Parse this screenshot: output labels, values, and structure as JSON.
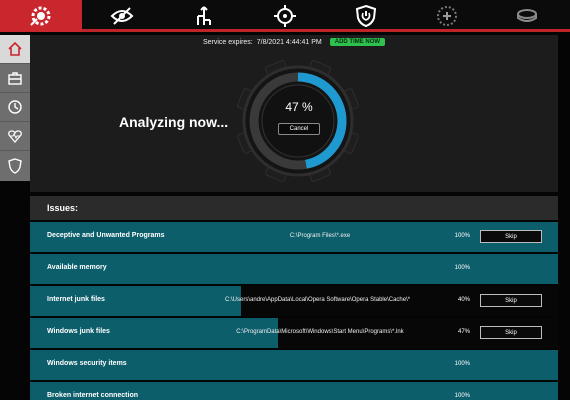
{
  "topbar": {
    "icons": [
      "app-logo-icon",
      "privacy-eye-off-icon",
      "network-icon",
      "crosshair-target-icon",
      "power-shield-icon",
      "controller-icon",
      "puck-icon"
    ]
  },
  "sidebar": {
    "items": [
      {
        "icon": "home-icon",
        "active": true
      },
      {
        "icon": "briefcase-icon",
        "active": false
      },
      {
        "icon": "clock-icon",
        "active": false
      },
      {
        "icon": "heart-pulse-icon",
        "active": false
      },
      {
        "icon": "shield-icon",
        "active": false
      }
    ]
  },
  "expiry": {
    "label": "Service expires:",
    "date": "7/8/2021 4:44:41 PM",
    "button": "ADD TIME NOW"
  },
  "scan": {
    "status": "Analyzing now...",
    "percent_label": "47 %",
    "progress": 0.47,
    "cancel": "Cancel"
  },
  "issues": {
    "title": "Issues:",
    "rows": [
      {
        "name": "Deceptive and Unwanted Programs",
        "path": "C:\\Program Files\\*.exe",
        "percent": "100%",
        "skip": "Skip",
        "progress": 1.0
      },
      {
        "name": "Available memory",
        "path": "",
        "percent": "100%",
        "skip": "",
        "progress": 1.0
      },
      {
        "name": "Internet junk files",
        "path": "C:\\Users\\andre\\AppData\\Local\\Opera Software\\Opera Stable\\Cache\\*",
        "percent": "40%",
        "skip": "Skip",
        "progress": 0.4
      },
      {
        "name": "Windows junk files",
        "path": "C:\\ProgramData\\Microsoft\\Windows\\Start Menu\\Programs\\*.lnk",
        "percent": "47%",
        "skip": "Skip",
        "progress": 0.47
      },
      {
        "name": "Windows security items",
        "path": "",
        "percent": "100%",
        "skip": "",
        "progress": 1.0
      },
      {
        "name": "Broken internet connection",
        "path": "",
        "percent": "100%",
        "skip": "",
        "progress": 1.0
      }
    ]
  },
  "colors": {
    "brand_red": "#c9262d",
    "teal": "#0d5e6b",
    "gauge_blue": "#1e9ad1",
    "add_time_green": "#2cc24d"
  }
}
